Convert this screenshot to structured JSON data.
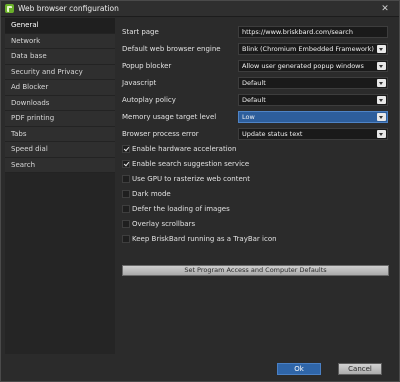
{
  "window": {
    "title": "Web browser configuration"
  },
  "sidebar": {
    "items": [
      {
        "label": "General"
      },
      {
        "label": "Network"
      },
      {
        "label": "Data base"
      },
      {
        "label": "Security and Privacy"
      },
      {
        "label": "Ad Blocker"
      },
      {
        "label": "Downloads"
      },
      {
        "label": "PDF printing"
      },
      {
        "label": "Tabs"
      },
      {
        "label": "Speed dial"
      },
      {
        "label": "Search"
      }
    ],
    "selected": "General"
  },
  "settings": {
    "start_page": {
      "label": "Start page",
      "value": "https://www.briskbard.com/search"
    },
    "engine": {
      "label": "Default web browser engine",
      "value": "Blink (Chromium Embedded Framework)"
    },
    "popup": {
      "label": "Popup blocker",
      "value": "Allow user generated popup windows"
    },
    "javascript": {
      "label": "Javascript",
      "value": "Default"
    },
    "autoplay": {
      "label": "Autoplay policy",
      "value": "Default"
    },
    "memory": {
      "label": "Memory usage target level",
      "value": "Low"
    },
    "process_error": {
      "label": "Browser process error",
      "value": "Update status text"
    }
  },
  "checkboxes": [
    {
      "label": "Enable hardware acceleration",
      "checked": true
    },
    {
      "label": "Enable search suggestion service",
      "checked": true
    },
    {
      "label": "Use GPU to rasterize web content",
      "checked": false
    },
    {
      "label": "Dark mode",
      "checked": false
    },
    {
      "label": "Defer the loading of images",
      "checked": false
    },
    {
      "label": "Overlay scrollbars",
      "checked": false
    },
    {
      "label": "Keep BriskBard running as a TrayBar icon",
      "checked": false
    }
  ],
  "buttons": {
    "defaults": "Set Program Access and Computer Defaults",
    "ok": "Ok",
    "cancel": "Cancel"
  },
  "colors": {
    "accent": "#2f65a8",
    "selection": "#2d5e9c",
    "brand": "#6ab02a"
  }
}
